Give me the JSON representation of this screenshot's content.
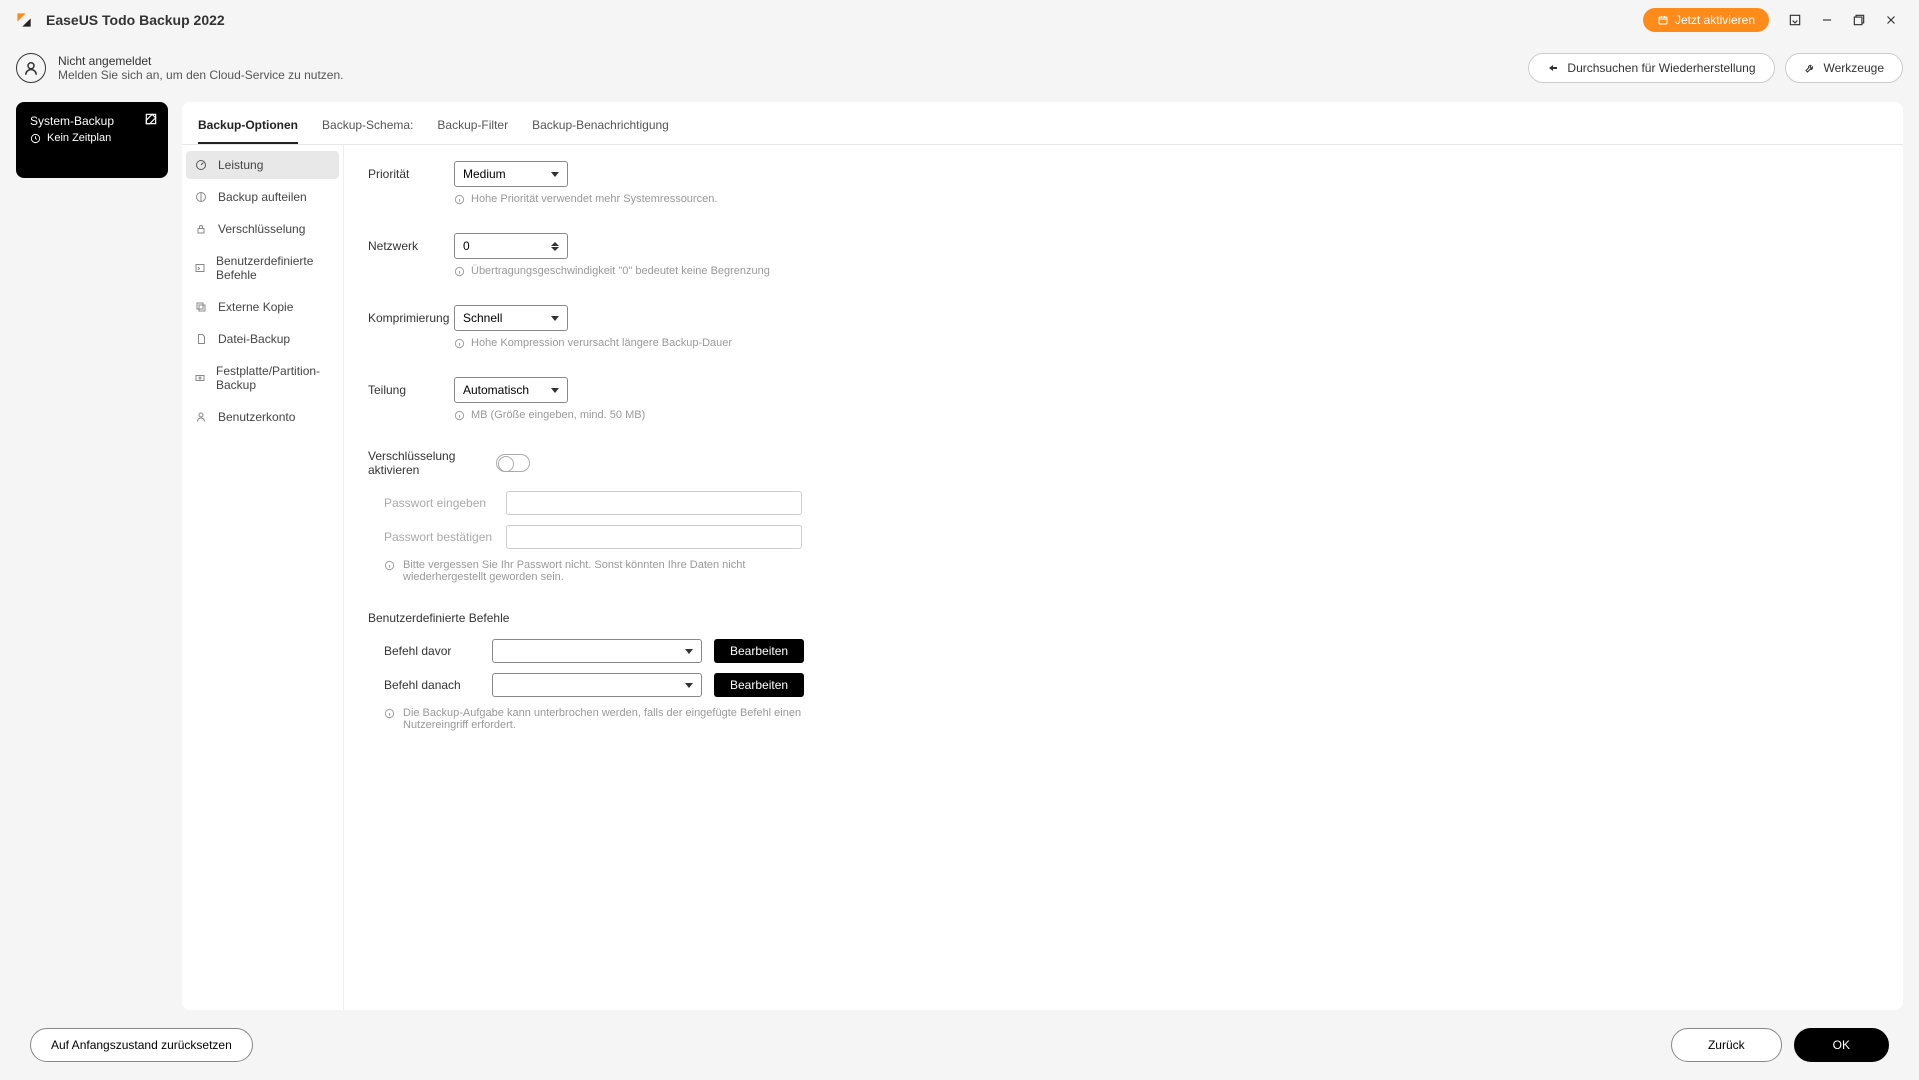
{
  "titlebar": {
    "app_name": "EaseUS Todo Backup 2022",
    "activate": "Jetzt aktivieren"
  },
  "header": {
    "user_status": "Nicht angemeldet",
    "user_hint": "Melden Sie sich an, um den Cloud-Service zu nutzen.",
    "browse_recovery": "Durchsuchen für Wiederherstellung",
    "tools": "Werkzeuge"
  },
  "sidebar_card": {
    "title": "System-Backup",
    "schedule": "Kein Zeitplan"
  },
  "tabs": {
    "options": "Backup-Optionen",
    "schema": "Backup-Schema:",
    "filter": "Backup-Filter",
    "notification": "Backup-Benachrichtigung"
  },
  "subnav": {
    "performance": "Leistung",
    "split": "Backup aufteilen",
    "encryption": "Verschlüsselung",
    "custom_cmd": "Benutzerdefinierte Befehle",
    "external_copy": "Externe Kopie",
    "file_backup": "Datei-Backup",
    "partition_backup": "Festplatte/Partition-Backup",
    "user_account": "Benutzerkonto"
  },
  "fields": {
    "priority": {
      "label": "Priorität",
      "value": "Medium",
      "hint": "Hohe Priorität verwendet mehr Systemressourcen."
    },
    "network": {
      "label": "Netzwerk",
      "value": "0",
      "hint": "Übertragungsgeschwindigkeit \"0\" bedeutet keine Begrenzung"
    },
    "compression": {
      "label": "Komprimierung",
      "value": "Schnell",
      "hint": "Hohe Kompression verursacht längere Backup-Dauer"
    },
    "split": {
      "label": "Teilung",
      "value": "Automatisch",
      "hint": "MB (Größe eingeben, mind. 50 MB)"
    },
    "encryption_toggle": {
      "label": "Verschlüsselung aktivieren"
    },
    "password": {
      "label": "Passwort eingeben"
    },
    "password_confirm": {
      "label": "Passwort bestätigen"
    },
    "password_hint": "Bitte vergessen Sie Ihr Passwort nicht. Sonst könnten Ihre Daten nicht wiederhergestellt geworden sein.",
    "custom_cmd_title": "Benutzerdefinierte Befehle",
    "cmd_before": {
      "label": "Befehl davor",
      "button": "Bearbeiten"
    },
    "cmd_after": {
      "label": "Befehl danach",
      "button": "Bearbeiten"
    },
    "cmd_hint": "Die Backup-Aufgabe kann unterbrochen werden, falls der eingefügte Befehl einen Nutzereingriff erfordert."
  },
  "footer": {
    "reset": "Auf Anfangszustand zurücksetzen",
    "back": "Zurück",
    "ok": "OK"
  }
}
